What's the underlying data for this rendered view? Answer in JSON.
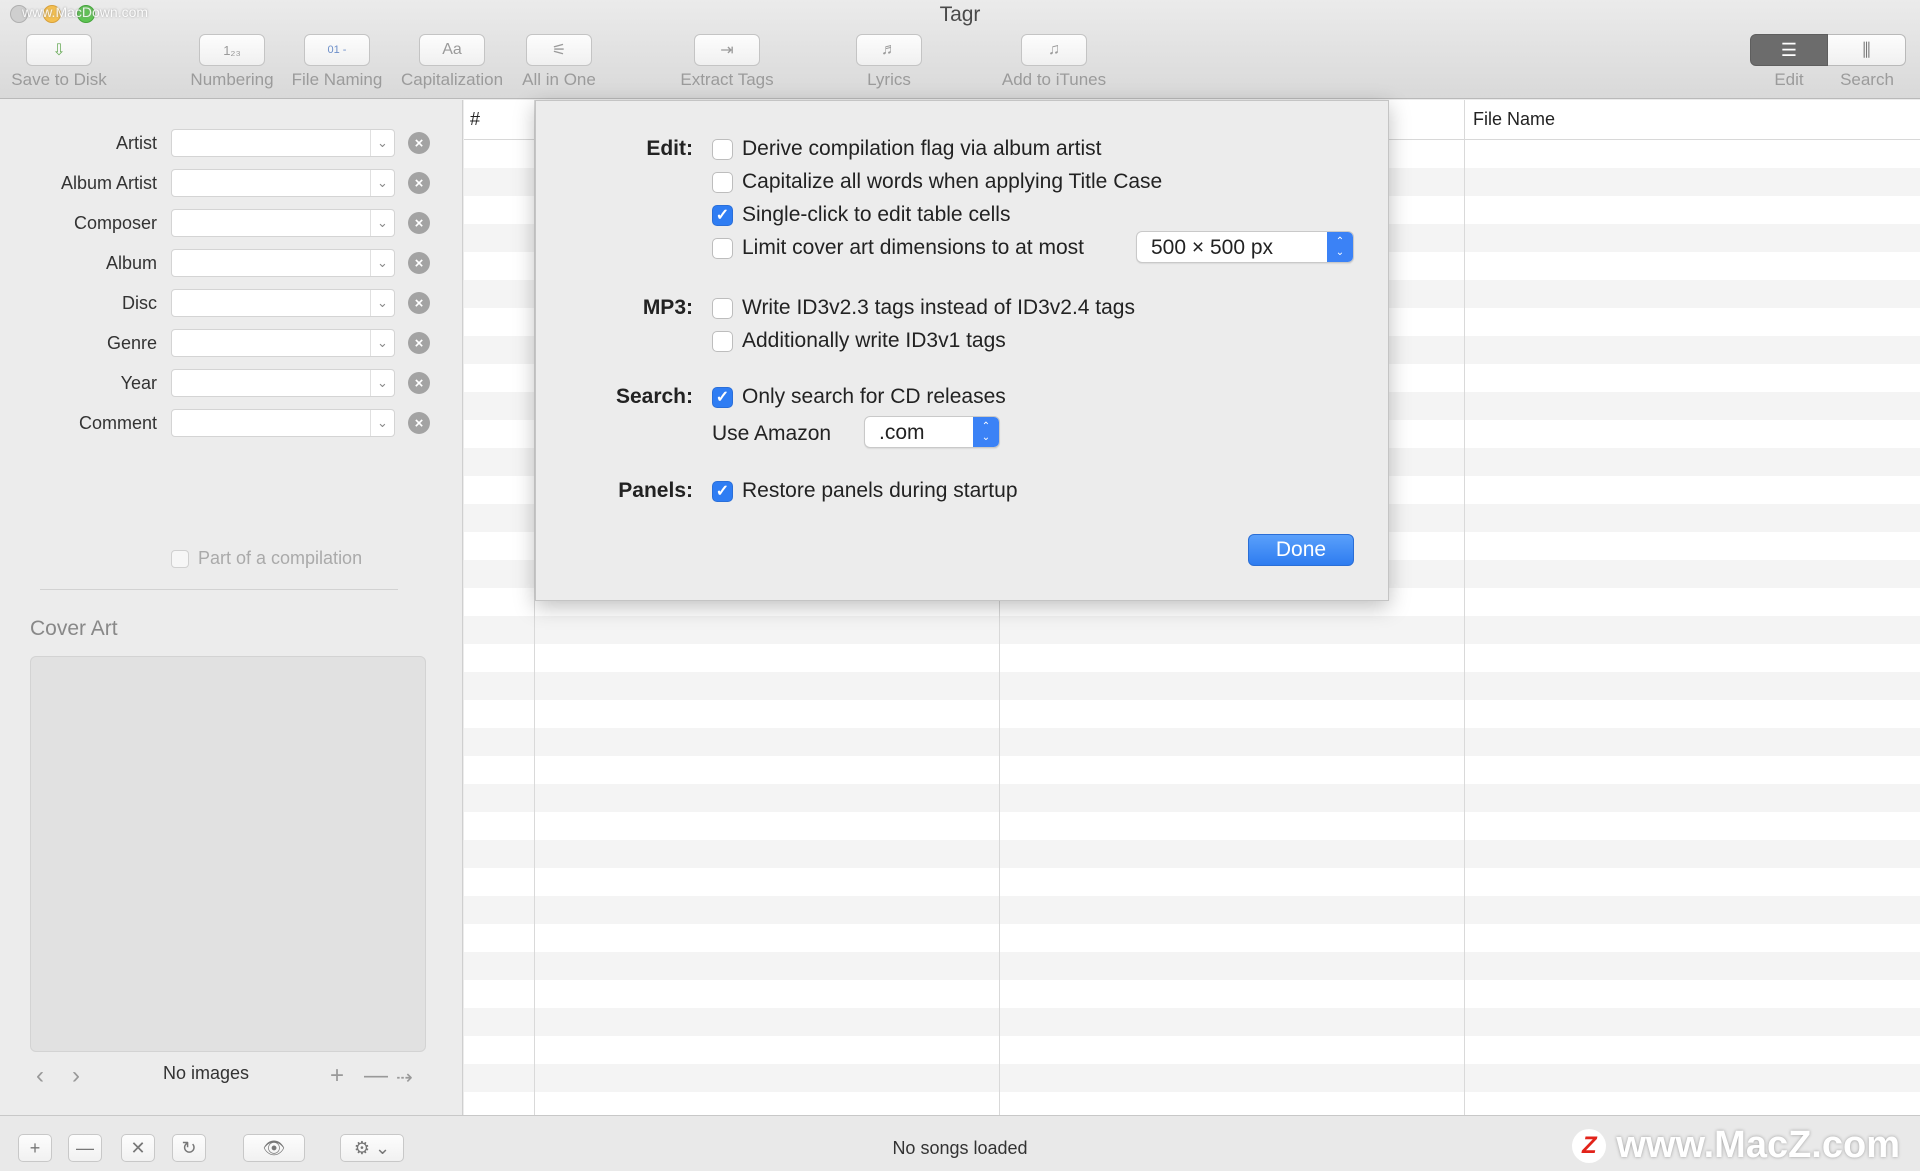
{
  "window": {
    "title": "Tagr",
    "watermark_top": "www.MacDown.com"
  },
  "toolbar": {
    "items": [
      {
        "label": "Save to Disk",
        "icon": "save-disk-icon",
        "glyph": "⇩"
      },
      {
        "label": "Numbering",
        "icon": "numbering-icon",
        "glyph": "1₂₃"
      },
      {
        "label": "File Naming",
        "icon": "file-naming-icon",
        "glyph": "01 -"
      },
      {
        "label": "Capitalization",
        "icon": "capitalization-icon",
        "glyph": "Aa"
      },
      {
        "label": "All in One",
        "icon": "all-in-one-icon",
        "glyph": "⚟"
      },
      {
        "label": "Extract Tags",
        "icon": "extract-tags-icon",
        "glyph": "⇥"
      },
      {
        "label": "Lyrics",
        "icon": "lyrics-icon",
        "glyph": "♬"
      },
      {
        "label": "Add to iTunes",
        "icon": "itunes-note-icon",
        "glyph": "♫"
      }
    ],
    "view_edit": "Edit",
    "view_search": "Search"
  },
  "sidebar": {
    "fields": [
      {
        "label": "Artist",
        "value": ""
      },
      {
        "label": "Album Artist",
        "value": ""
      },
      {
        "label": "Composer",
        "value": ""
      },
      {
        "label": "Album",
        "value": ""
      },
      {
        "label": "Disc",
        "value": ""
      },
      {
        "label": "Genre",
        "value": ""
      },
      {
        "label": "Year",
        "value": ""
      },
      {
        "label": "Comment",
        "value": ""
      }
    ],
    "compilation_label": "Part of a compilation",
    "compilation_checked": false,
    "cover_art_title": "Cover Art",
    "no_images": "No images"
  },
  "table": {
    "columns": [
      "#",
      "File Name"
    ]
  },
  "preferences": {
    "edit_section": "Edit:",
    "edit_options": [
      {
        "label": "Derive compilation flag via album artist",
        "checked": false
      },
      {
        "label": "Capitalize all words when applying Title Case",
        "checked": false
      },
      {
        "label": "Single-click to edit table cells",
        "checked": true
      },
      {
        "label": "Limit cover art dimensions to at most",
        "checked": false
      }
    ],
    "cover_size_value": "500 × 500 px",
    "mp3_section": "MP3:",
    "mp3_options": [
      {
        "label": "Write ID3v2.3 tags instead of ID3v2.4 tags",
        "checked": false
      },
      {
        "label": "Additionally write ID3v1 tags",
        "checked": false
      }
    ],
    "search_section": "Search:",
    "search_option": {
      "label": "Only search for CD releases",
      "checked": true
    },
    "amazon_label": "Use Amazon",
    "amazon_value": ".com",
    "panels_section": "Panels:",
    "panels_option": {
      "label": "Restore panels during startup",
      "checked": true
    },
    "done_label": "Done"
  },
  "bottombar": {
    "status": "No songs loaded",
    "watermark": "www.MacZ.com"
  },
  "colors": {
    "accent": "#2f7df3"
  }
}
